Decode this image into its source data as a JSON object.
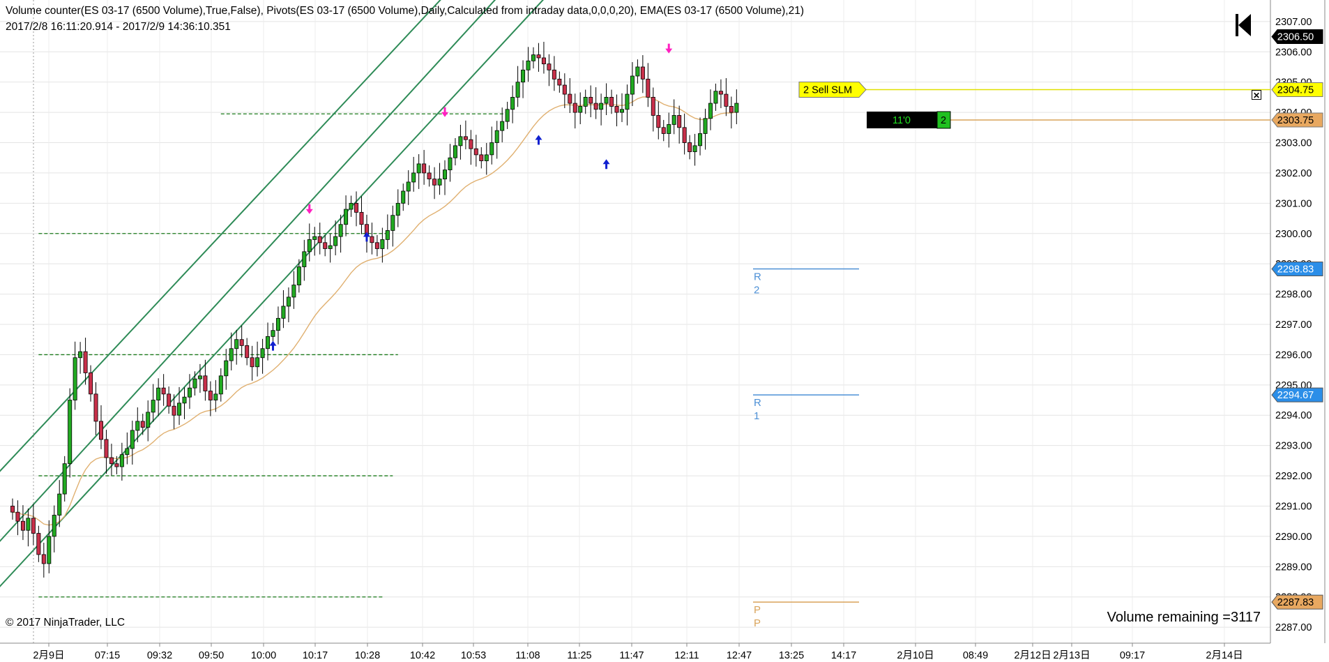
{
  "header": {
    "indicators": "Volume counter(ES 03-17 (6500 Volume),True,False), Pivots(ES 03-17 (6500 Volume),Daily,Calculated from intraday data,0,0,0,20), EMA(ES 03-17 (6500 Volume),21)",
    "range": "2017/2/8 16:11:20.914 - 2017/2/9 14:36:10.351"
  },
  "footer": {
    "copyright": "© 2017 NinjaTrader, LLC",
    "volume_remaining": "Volume remaining =3117"
  },
  "colors": {
    "bull": "#22aa22",
    "bear": "#c8304a",
    "channel": "#2e8b57",
    "hline": "#1a7a1a",
    "ema": "#e0b070",
    "pivot_r": "#4d90d6",
    "pivot_p": "#d9a35a",
    "order": "#ffff00",
    "position": "#d9a35a",
    "arrow_up": "#1020d0",
    "arrow_down": "#ff20c0"
  },
  "icons": {
    "skip": "skip-to-end-icon",
    "close": "close-order-icon"
  },
  "chart_data": {
    "type": "candlestick",
    "y_ticks": [
      "2307.00",
      "2306.00",
      "2305.00",
      "2304.00",
      "2303.00",
      "2302.00",
      "2301.00",
      "2300.00",
      "2299.00",
      "2298.00",
      "2297.00",
      "2296.00",
      "2295.00",
      "2294.00",
      "2293.00",
      "2292.00",
      "2291.00",
      "2290.00",
      "2289.00",
      "2288.00",
      "2287.00"
    ],
    "ylim": [
      2286.75,
      2307.25
    ],
    "x_labels": [
      "2月9日",
      "07:15",
      "09:32",
      "09:50",
      "10:00",
      "10:17",
      "10:28",
      "10:42",
      "10:53",
      "11:08",
      "11:25",
      "11:47",
      "12:11",
      "12:47",
      "13:25",
      "14:17",
      "2月10日",
      "08:49",
      "2月12日",
      "2月13日",
      "09:17",
      "2月14日"
    ],
    "bar_count": 140,
    "closes": [
      2290.8,
      2290.5,
      2290.2,
      2290.6,
      2290.1,
      2289.4,
      2289.1,
      2290.0,
      2290.7,
      2291.4,
      2292.4,
      2294.5,
      2295.9,
      2296.1,
      2295.4,
      2294.7,
      2293.8,
      2293.2,
      2292.6,
      2292.4,
      2292.3,
      2292.7,
      2292.9,
      2293.5,
      2293.8,
      2293.6,
      2294.1,
      2294.5,
      2294.9,
      2294.7,
      2294.3,
      2294.0,
      2294.4,
      2294.6,
      2294.9,
      2295.2,
      2295.3,
      2294.8,
      2294.5,
      2294.7,
      2295.3,
      2295.8,
      2296.2,
      2296.5,
      2296.3,
      2295.9,
      2295.6,
      2295.9,
      2296.2,
      2296.6,
      2296.8,
      2297.2,
      2297.6,
      2297.9,
      2298.3,
      2298.9,
      2299.4,
      2299.8,
      2299.9,
      2299.7,
      2299.5,
      2299.6,
      2299.9,
      2300.3,
      2300.8,
      2301.0,
      2300.7,
      2300.3,
      2299.9,
      2299.7,
      2299.5,
      2299.8,
      2300.1,
      2300.6,
      2301.0,
      2301.4,
      2301.7,
      2302.0,
      2302.3,
      2302.0,
      2301.8,
      2301.6,
      2301.8,
      2302.1,
      2302.5,
      2302.9,
      2303.2,
      2303.1,
      2302.8,
      2302.6,
      2302.4,
      2302.6,
      2303.0,
      2303.4,
      2303.7,
      2304.1,
      2304.5,
      2305.0,
      2305.4,
      2305.7,
      2305.9,
      2305.8,
      2305.6,
      2305.4,
      2305.1,
      2304.9,
      2304.6,
      2304.3,
      2304.0,
      2304.2,
      2304.5,
      2304.3,
      2304.1,
      2304.3,
      2304.5,
      2304.2,
      2304.0,
      2304.1,
      2304.6,
      2305.2,
      2305.5,
      2305.1,
      2304.5,
      2303.9,
      2303.5,
      2303.3,
      2303.6,
      2303.9,
      2303.5,
      2303.0,
      2302.7,
      2302.9,
      2303.3,
      2303.8,
      2304.3,
      2304.7,
      2304.6,
      2304.2,
      2304.0,
      2304.3
    ],
    "ema_start": 2290.8,
    "ema_period": 21,
    "channel": [
      {
        "a": [
          0,
          2290.3
        ],
        "b": [
          100,
          2309.1
        ]
      },
      {
        "a": [
          0,
          2292.6
        ],
        "b": [
          100,
          2311.0
        ]
      },
      {
        "a": [
          0,
          2288.8
        ],
        "b": [
          105,
          2308.3
        ]
      }
    ],
    "channel_y2": [
      {
        "at": 0,
        "y": 2293.2
      }
    ],
    "hlines": [
      {
        "y": 2303.95,
        "x_from": 40,
        "x_to": 95
      },
      {
        "y": 2300.0,
        "x_from": 5,
        "x_to": 72
      },
      {
        "y": 2296.0,
        "x_from": 5,
        "x_to": 74
      },
      {
        "y": 2292.0,
        "x_from": 5,
        "x_to": 73
      },
      {
        "y": 2288.0,
        "x_from": 5,
        "x_to": 71
      }
    ],
    "pivots": [
      {
        "name": "R2",
        "y": 2298.83,
        "label1": "R",
        "label2": "2",
        "price": "2298.83",
        "kind": "r"
      },
      {
        "name": "R1",
        "y": 2294.67,
        "label1": "R",
        "label2": "1",
        "price": "2294.67",
        "kind": "r"
      },
      {
        "name": "PP",
        "y": 2287.83,
        "label1": "P",
        "label2": "P",
        "price": "2287.83",
        "kind": "p"
      }
    ],
    "last_price": {
      "label": "2306.50",
      "y": 2306.5
    },
    "order": {
      "label": "2 Sell SLM",
      "price": "2304.75",
      "y": 2304.75
    },
    "position": {
      "label": "11'0",
      "qty": "2",
      "price": "2303.75",
      "y": 2303.75
    },
    "arrows_down": [
      {
        "bar": 57,
        "y": 2300.3
      },
      {
        "bar": 83,
        "y": 2303.5
      },
      {
        "bar": 126,
        "y": 2305.6
      }
    ],
    "arrows_up": [
      {
        "bar": 50,
        "y": 2296.8
      },
      {
        "bar": 68,
        "y": 2300.4
      },
      {
        "bar": 101,
        "y": 2303.6
      },
      {
        "bar": 114,
        "y": 2302.8
      }
    ]
  }
}
